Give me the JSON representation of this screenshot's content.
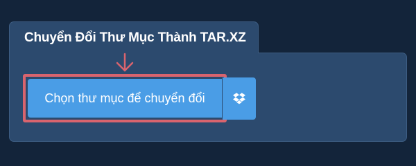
{
  "tab": {
    "title": "Chuyển Đổi Thư Mục Thành TAR.XZ"
  },
  "actions": {
    "choose_folder_label": "Chọn thư mục để chuyển đổi",
    "dropbox_icon": "dropbox-icon",
    "pointer_icon": "arrow-down-icon"
  },
  "colors": {
    "page_background": "#13243a",
    "panel_background": "#2c4a6e",
    "button": "#4a9de6",
    "highlight": "#d9646e"
  }
}
